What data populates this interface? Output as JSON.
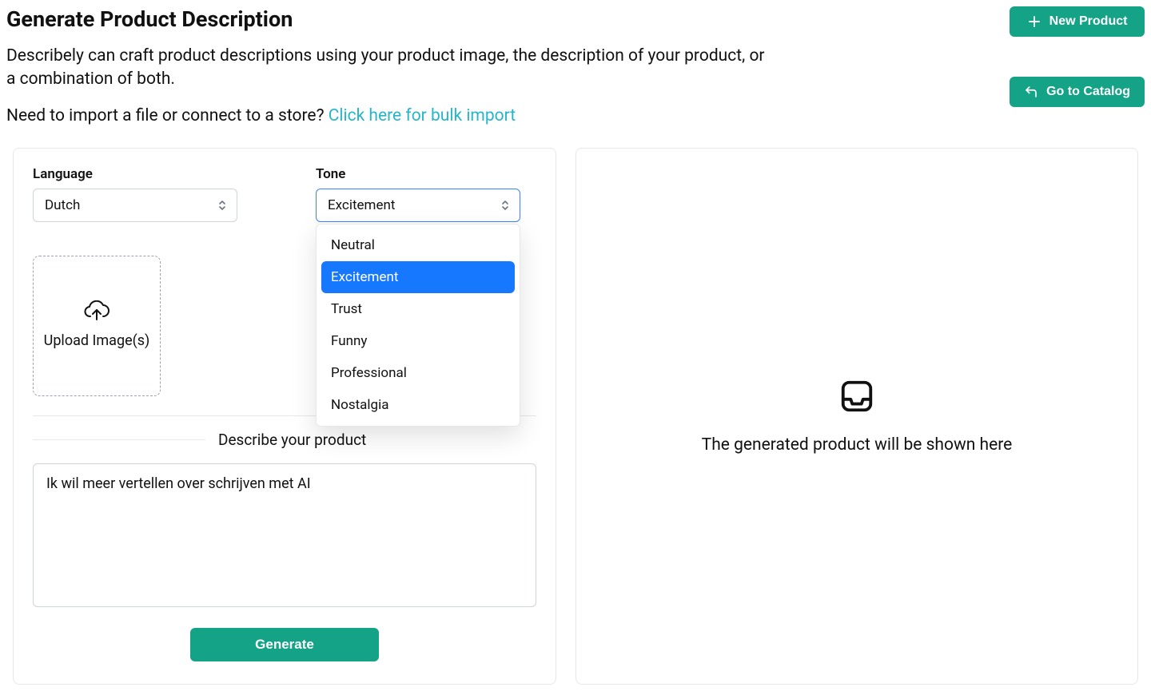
{
  "header": {
    "title": "Generate Product Description",
    "subtitle": "Describely can craft product descriptions using your product image, the description of your product, or a combination of both.",
    "import_prompt": "Need to import a file or connect to a store? ",
    "import_link": "Click here for bulk import"
  },
  "buttons": {
    "new_product": "New Product",
    "go_to_catalog": "Go to Catalog",
    "generate": "Generate"
  },
  "form": {
    "language_label": "Language",
    "language_value": "Dutch",
    "tone_label": "Tone",
    "tone_value": "Excitement",
    "tone_options": [
      "Neutral",
      "Excitement",
      "Trust",
      "Funny",
      "Professional",
      "Nostalgia"
    ],
    "upload_label": "Upload Image(s)",
    "divider_text": "Describe your product",
    "description_value": "Ik wil meer vertellen over schrijven met AI"
  },
  "preview": {
    "empty_text": "The generated product will be shown here"
  },
  "colors": {
    "accent": "#14a387",
    "link": "#26b5c9",
    "option_selected": "#1677ff"
  }
}
